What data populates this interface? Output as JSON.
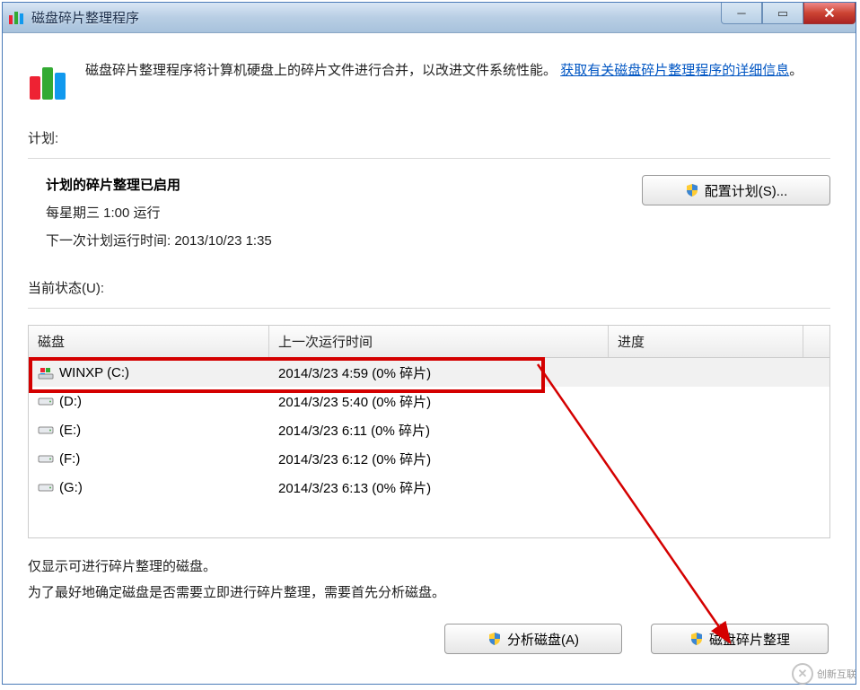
{
  "window": {
    "title": "磁盘碎片整理程序"
  },
  "info": {
    "text_pre": "磁盘碎片整理程序将计算机硬盘上的碎片文件进行合并，以改进文件系统性能。",
    "link": "获取有关磁盘碎片整理程序的详细信息",
    "link_tail": "。"
  },
  "schedule": {
    "label": "计划:",
    "enabled": "计划的碎片整理已启用",
    "run_at": "每星期三   1:00 运行",
    "next_run": "下一次计划运行时间: 2013/10/23 1:35",
    "configure_btn": "配置计划(S)..."
  },
  "status": {
    "label": "当前状态(U):"
  },
  "table": {
    "col_disk": "磁盘",
    "col_last": "上一次运行时间",
    "col_prog": "进度",
    "rows": [
      {
        "name": "WINXP (C:)",
        "last": "2014/3/23 4:59 (0% 碎片)",
        "win": true
      },
      {
        "name": "(D:)",
        "last": "2014/3/23 5:40 (0% 碎片)",
        "win": false
      },
      {
        "name": "(E:)",
        "last": "2014/3/23 6:11 (0% 碎片)",
        "win": false
      },
      {
        "name": "(F:)",
        "last": "2014/3/23 6:12 (0% 碎片)",
        "win": false
      },
      {
        "name": "(G:)",
        "last": "2014/3/23 6:13 (0% 碎片)",
        "win": false
      }
    ]
  },
  "note": {
    "line1": "仅显示可进行碎片整理的磁盘。",
    "line2": "为了最好地确定磁盘是否需要立即进行碎片整理，需要首先分析磁盘。"
  },
  "actions": {
    "analyze": "分析磁盘(A)",
    "defrag": "磁盘碎片整理"
  },
  "watermark": {
    "brand": "创新互联"
  }
}
